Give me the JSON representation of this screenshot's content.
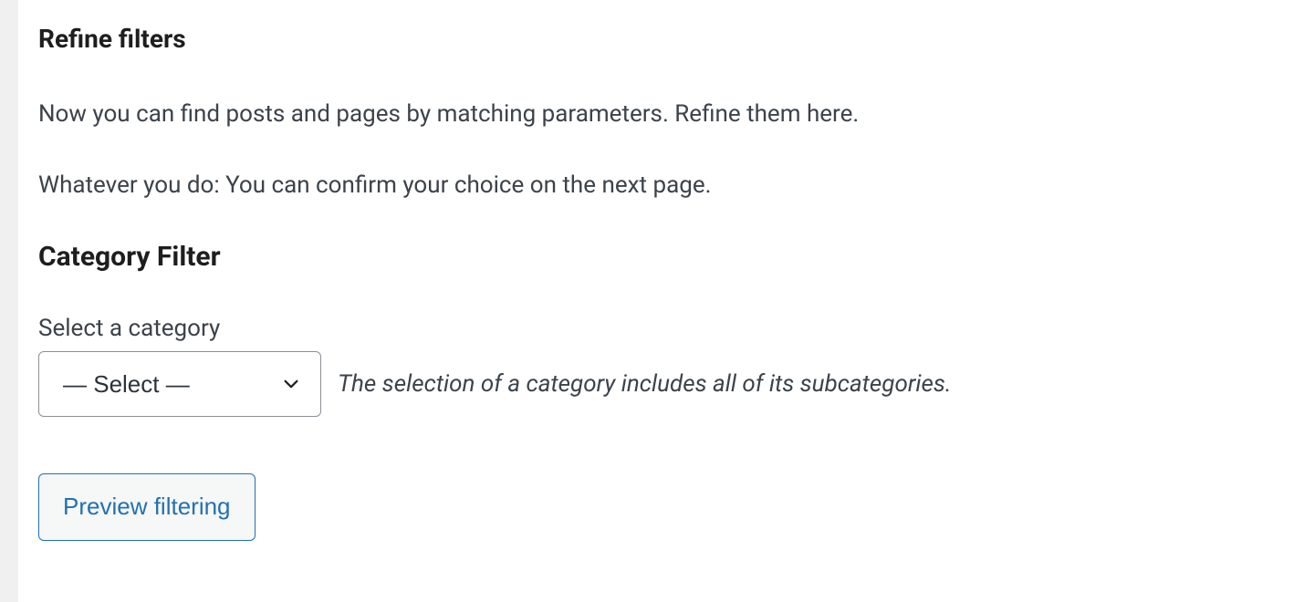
{
  "section": {
    "title": "Refine filters",
    "intro1": "Now you can find posts and pages by matching parameters. Refine them here.",
    "intro2": "Whatever you do: You can confirm your choice on the next page."
  },
  "category_filter": {
    "heading": "Category Filter",
    "label": "Select a category",
    "selected": "— Select —",
    "hint": "The selection of a category includes all of its subcategories."
  },
  "actions": {
    "preview_label": "Preview filtering"
  }
}
